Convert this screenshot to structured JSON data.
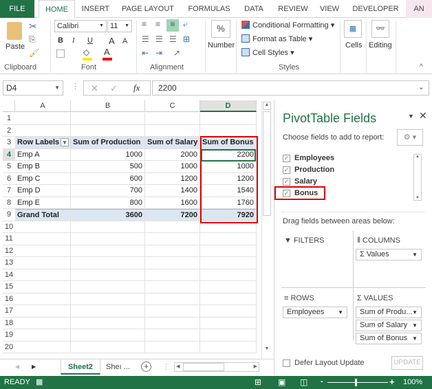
{
  "ribbon": {
    "tabs": [
      "FILE",
      "HOME",
      "INSERT",
      "PAGE LAYOUT",
      "FORMULAS",
      "DATA",
      "REVIEW",
      "VIEW",
      "DEVELOPER",
      "AN"
    ],
    "active_tab": "HOME",
    "clipboard": {
      "paste": "Paste",
      "label": "Clipboard"
    },
    "font": {
      "name": "Calibri",
      "size": "11",
      "bold": "B",
      "italic": "I",
      "underline": "U",
      "label": "Font"
    },
    "alignment": {
      "label": "Alignment"
    },
    "number": {
      "symbol": "%",
      "label": "Number"
    },
    "styles": {
      "conditional": "Conditional Formatting",
      "format_table": "Format as Table",
      "cell_styles": "Cell Styles",
      "label": "Styles"
    },
    "cells": {
      "label": "Cells"
    },
    "editing": {
      "label": "Editing"
    }
  },
  "formula_bar": {
    "name_box": "D4",
    "fx": "fx",
    "value": "2200"
  },
  "grid": {
    "columns": [
      "A",
      "B",
      "C",
      "D"
    ],
    "selected_column": "D",
    "rows": [
      "1",
      "2",
      "3",
      "4",
      "5",
      "6",
      "7",
      "8",
      "9",
      "10",
      "11",
      "12",
      "13",
      "14",
      "15",
      "16",
      "17",
      "18",
      "19",
      "20"
    ],
    "pivot": {
      "headers": [
        "Row Labels",
        "Sum of Production",
        "Sum of Salary",
        "Sum of Bonus"
      ],
      "data": [
        [
          "Emp A",
          "1000",
          "2000",
          "2200"
        ],
        [
          "Emp B",
          "500",
          "1000",
          "1000"
        ],
        [
          "Emp C",
          "600",
          "1200",
          "1200"
        ],
        [
          "Emp D",
          "700",
          "1400",
          "1540"
        ],
        [
          "Emp E",
          "800",
          "1600",
          "1760"
        ]
      ],
      "total": [
        "Grand Total",
        "3600",
        "7200",
        "7920"
      ]
    }
  },
  "pane": {
    "title": "PivotTable Fields",
    "choose": "Choose fields to add to report:",
    "fields": [
      {
        "name": "Employees",
        "checked": true
      },
      {
        "name": "Production",
        "checked": true
      },
      {
        "name": "Salary",
        "checked": true
      },
      {
        "name": "Bonus",
        "checked": true
      }
    ],
    "drag_hint": "Drag fields between areas below:",
    "filters": "FILTERS",
    "columns": "COLUMNS",
    "columns_items": [
      "Values"
    ],
    "rows": "ROWS",
    "rows_items": [
      "Employees"
    ],
    "values": "VALUES",
    "values_items": [
      "Sum of Produ...",
      "Sum of Salary",
      "Sum of Bonus"
    ],
    "defer": "Defer Layout Update",
    "update": "UPDATE"
  },
  "sheets": {
    "tabs": [
      "Sheet2",
      "Sheı ..."
    ],
    "active": "Sheet2"
  },
  "status": {
    "mode": "READY",
    "zoom": "100%"
  },
  "colors": {
    "excel_green": "#217346",
    "highlight_red": "#e00000",
    "pivot_header": "#dce6f1",
    "pane_title": "#217346"
  }
}
